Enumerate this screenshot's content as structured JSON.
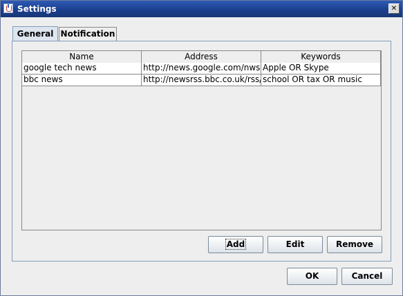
{
  "window": {
    "title": "Settings",
    "close_glyph": "✕"
  },
  "tabs": [
    {
      "label": "General",
      "active": true
    },
    {
      "label": "Notification",
      "active": false
    }
  ],
  "table": {
    "columns": [
      "Name",
      "Address",
      "Keywords"
    ],
    "rows": [
      [
        "google tech news",
        "http://news.google.com/nwsh...",
        "Apple OR Skype"
      ],
      [
        "bbc news",
        "http://newsrss.bbc.co.uk/rss/...",
        "school OR tax OR music"
      ]
    ]
  },
  "table_buttons": {
    "add": "Add",
    "edit": "Edit",
    "remove": "Remove"
  },
  "dialog_buttons": {
    "ok": "OK",
    "cancel": "Cancel"
  },
  "colors": {
    "titlebar": "#1c3f8e",
    "window_bg": "#eeeeee",
    "panel_border": "#7f9db9"
  },
  "icons": {
    "app": "java-cup-icon",
    "close": "close-icon"
  }
}
